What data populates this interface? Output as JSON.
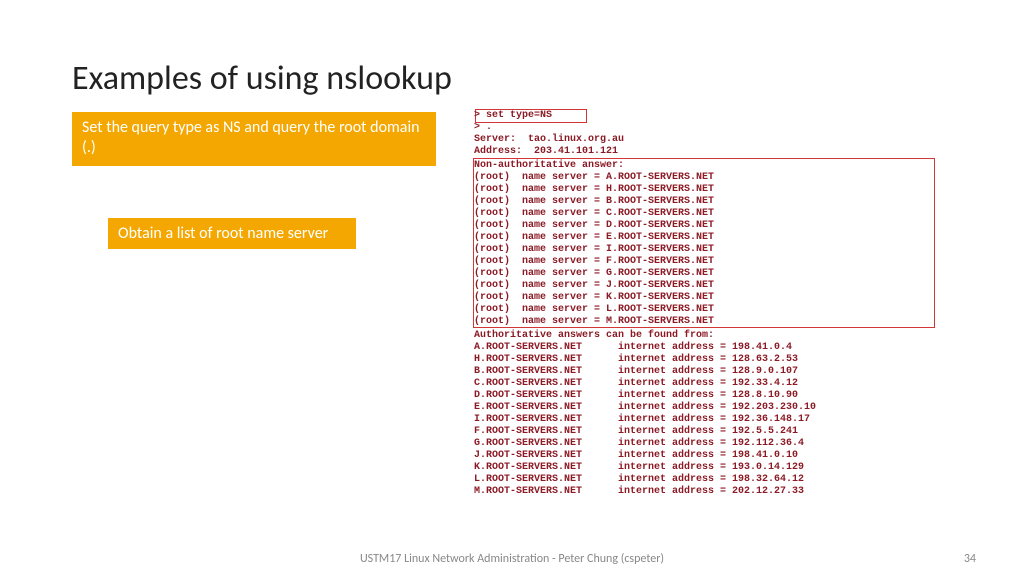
{
  "title": "Examples of using nslookup",
  "callouts": {
    "c1": "Set the query type as NS and query the root domain (.)",
    "c2": "Obtain a list of root name server"
  },
  "terminal": {
    "cmd_set": "> set type=NS",
    "cmd_query": "> .",
    "server": "Server:  tao.linux.org.au",
    "address": "Address:  203.41.101.121",
    "nonauth_header": "Non-authoritative answer:",
    "root_servers": [
      "(root)  name server = A.ROOT-SERVERS.NET",
      "(root)  name server = H.ROOT-SERVERS.NET",
      "(root)  name server = B.ROOT-SERVERS.NET",
      "(root)  name server = C.ROOT-SERVERS.NET",
      "(root)  name server = D.ROOT-SERVERS.NET",
      "(root)  name server = E.ROOT-SERVERS.NET",
      "(root)  name server = I.ROOT-SERVERS.NET",
      "(root)  name server = F.ROOT-SERVERS.NET",
      "(root)  name server = G.ROOT-SERVERS.NET",
      "(root)  name server = J.ROOT-SERVERS.NET",
      "(root)  name server = K.ROOT-SERVERS.NET",
      "(root)  name server = L.ROOT-SERVERS.NET",
      "(root)  name server = M.ROOT-SERVERS.NET"
    ],
    "auth_header": "Authoritative answers can be found from:",
    "addresses": [
      "A.ROOT-SERVERS.NET      internet address = 198.41.0.4",
      "H.ROOT-SERVERS.NET      internet address = 128.63.2.53",
      "B.ROOT-SERVERS.NET      internet address = 128.9.0.107",
      "C.ROOT-SERVERS.NET      internet address = 192.33.4.12",
      "D.ROOT-SERVERS.NET      internet address = 128.8.10.90",
      "E.ROOT-SERVERS.NET      internet address = 192.203.230.10",
      "I.ROOT-SERVERS.NET      internet address = 192.36.148.17",
      "F.ROOT-SERVERS.NET      internet address = 192.5.5.241",
      "G.ROOT-SERVERS.NET      internet address = 192.112.36.4",
      "J.ROOT-SERVERS.NET      internet address = 198.41.0.10",
      "K.ROOT-SERVERS.NET      internet address = 193.0.14.129",
      "L.ROOT-SERVERS.NET      internet address = 198.32.64.12",
      "M.ROOT-SERVERS.NET      internet address = 202.12.27.33"
    ]
  },
  "footer": "USTM17 Linux Network Administration - Peter Chung (cspeter)",
  "page_number": "34"
}
